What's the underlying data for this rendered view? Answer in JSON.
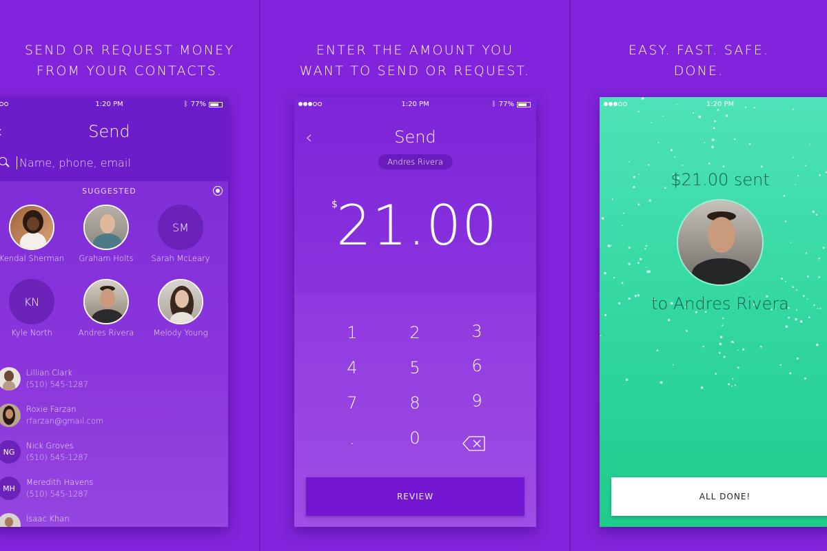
{
  "panels": [
    {
      "caption_line1": "SEND OR REQUEST MONEY",
      "caption_line2": "FROM YOUR CONTACTS."
    },
    {
      "caption_line1": "ENTER THE AMOUNT YOU",
      "caption_line2": "WANT TO SEND OR REQUEST."
    },
    {
      "caption_line1": "EASY. FAST. SAFE.",
      "caption_line2": "DONE."
    }
  ],
  "status_bar": {
    "time": "1:20 PM",
    "battery": "77%"
  },
  "send_screen": {
    "title": "Send",
    "back_glyph": "‹",
    "search_placeholder": "Name, phone, email",
    "suggested_label": "SUGGESTED",
    "suggested": [
      {
        "name": "Kendal Sherman",
        "type": "photo"
      },
      {
        "name": "Graham Holts",
        "type": "photo"
      },
      {
        "name": "Sarah McLeary",
        "initials": "SM"
      },
      {
        "name": "Kyle North",
        "initials": "KN"
      },
      {
        "name": "Andres Rivera",
        "type": "photo"
      },
      {
        "name": "Melody Young",
        "type": "photo"
      }
    ],
    "contacts": [
      {
        "name": "Lillian Clark",
        "detail": "(510) 545-1287"
      },
      {
        "name": "Roxie Farzan",
        "detail": "rfarzan@gmail.com"
      },
      {
        "name": "Nick Groves",
        "detail": "(510) 545-1287",
        "initials": "NG"
      },
      {
        "name": "Meredith Havens",
        "detail": "(510) 545-1287",
        "initials": "MH"
      },
      {
        "name": "Isaac Khan",
        "detail": ""
      }
    ]
  },
  "amount_screen": {
    "title": "Send",
    "back_glyph": "‹",
    "recipient": "Andres Rivera",
    "currency": "$",
    "amount": "21.00",
    "keys": [
      "1",
      "2",
      "3",
      "4",
      "5",
      "6",
      "7",
      "8",
      "9",
      ".",
      "0"
    ],
    "review_label": "REVIEW"
  },
  "done_screen": {
    "sent_text": "$21.00 sent",
    "to_text": "to Andres Rivera",
    "all_done_label": "ALL DONE!"
  },
  "colors": {
    "background": "#8224db",
    "accent_dark": "#6c1cc9",
    "success": "#33d7a1"
  }
}
